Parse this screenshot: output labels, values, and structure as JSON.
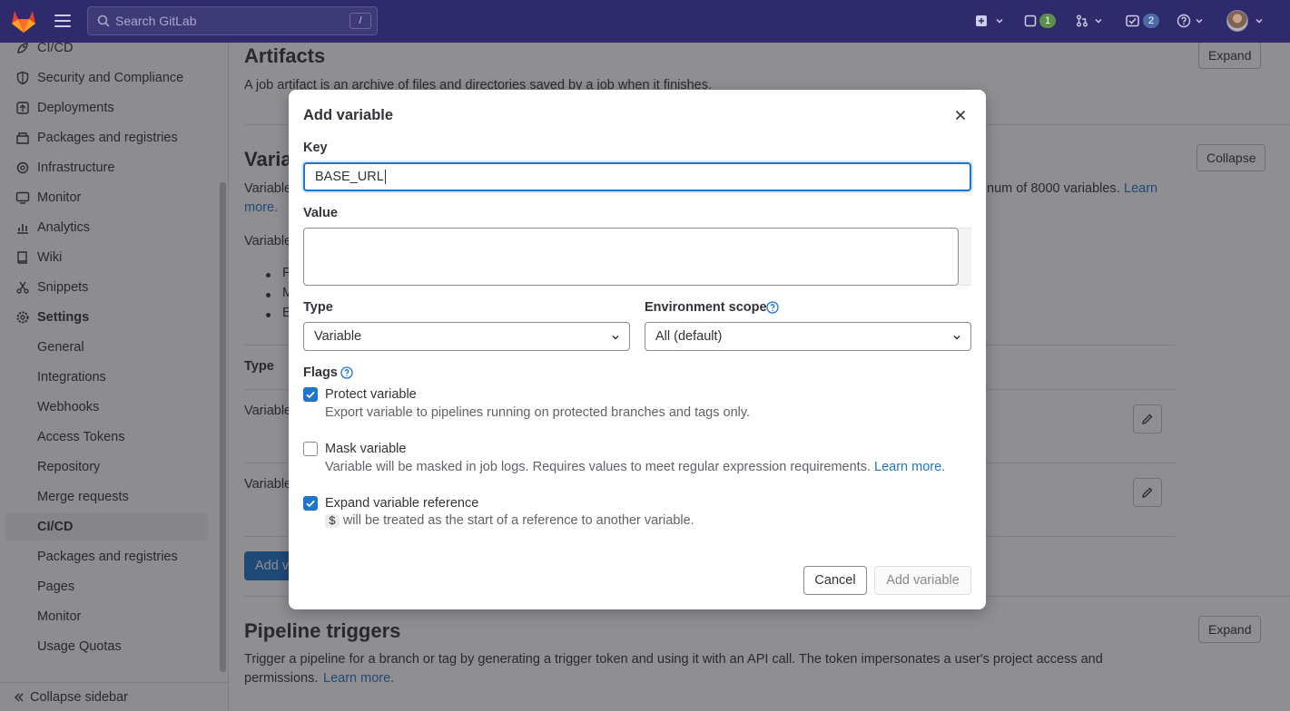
{
  "topbar": {
    "search_placeholder": "Search GitLab",
    "search_shortcut": "/",
    "issues_count": "1",
    "todos_count": "2"
  },
  "sidebar": {
    "items": [
      {
        "label": "CI/CD",
        "icon": "rocket-icon"
      },
      {
        "label": "Security and Compliance",
        "icon": "shield-icon"
      },
      {
        "label": "Deployments",
        "icon": "deployments-icon"
      },
      {
        "label": "Packages and registries",
        "icon": "package-icon"
      },
      {
        "label": "Infrastructure",
        "icon": "cloud-gear-icon"
      },
      {
        "label": "Monitor",
        "icon": "monitor-icon"
      },
      {
        "label": "Analytics",
        "icon": "chart-icon"
      },
      {
        "label": "Wiki",
        "icon": "book-icon"
      },
      {
        "label": "Snippets",
        "icon": "scissors-icon"
      },
      {
        "label": "Settings",
        "icon": "gear-icon"
      }
    ],
    "settings_sub": [
      "General",
      "Integrations",
      "Webhooks",
      "Access Tokens",
      "Repository",
      "Merge requests",
      "CI/CD",
      "Packages and registries",
      "Pages",
      "Monitor",
      "Usage Quotas"
    ],
    "collapse_label": "Collapse sidebar"
  },
  "main": {
    "artifacts_title": "Artifacts",
    "artifacts_desc": "A job artifact is an archive of files and directories saved by a job when it finishes.",
    "expand_label": "Expand",
    "variables_title_partial": "Varia",
    "collapse_label": "Collapse",
    "variables_desc_start": "Variable",
    "variables_desc_end": "num of 8000 variables.",
    "learn_more": "Learn",
    "learn_more_2": "more.",
    "variables_line2": "Variable",
    "bullets": [
      "P",
      "M",
      "E"
    ],
    "table_type_header": "Type",
    "row1_type": "Variable",
    "row2_type": "Variable",
    "add_variable_partial": "Add v",
    "pipeline_triggers_title": "Pipeline triggers",
    "pipeline_triggers_desc": "Trigger a pipeline for a branch or tag by generating a trigger token and using it with an API call. The token impersonates a user's project access and",
    "pipeline_triggers_desc2": "permissions.",
    "pipeline_learn_more": "Learn more."
  },
  "modal": {
    "title": "Add variable",
    "key_label": "Key",
    "key_value": "BASE_URL",
    "value_label": "Value",
    "value_value": "",
    "type_label": "Type",
    "type_selected": "Variable",
    "env_label": "Environment scope",
    "env_selected": "All (default)",
    "flags_label": "Flags",
    "protect_label": "Protect variable",
    "protect_help": "Export variable to pipelines running on protected branches and tags only.",
    "protect_checked": true,
    "mask_label": "Mask variable",
    "mask_help": "Variable will be masked in job logs. Requires values to meet regular expression requirements.",
    "mask_learn_more": "Learn more.",
    "mask_checked": false,
    "expand_label": "Expand variable reference",
    "expand_code": "$",
    "expand_help": "will be treated as the start of a reference to another variable.",
    "expand_checked": true,
    "cancel_label": "Cancel",
    "add_label": "Add variable"
  },
  "colors": {
    "navbar": "#2f2a6b",
    "link": "#1f75cb",
    "checkbox_on": "#1f75cb"
  }
}
